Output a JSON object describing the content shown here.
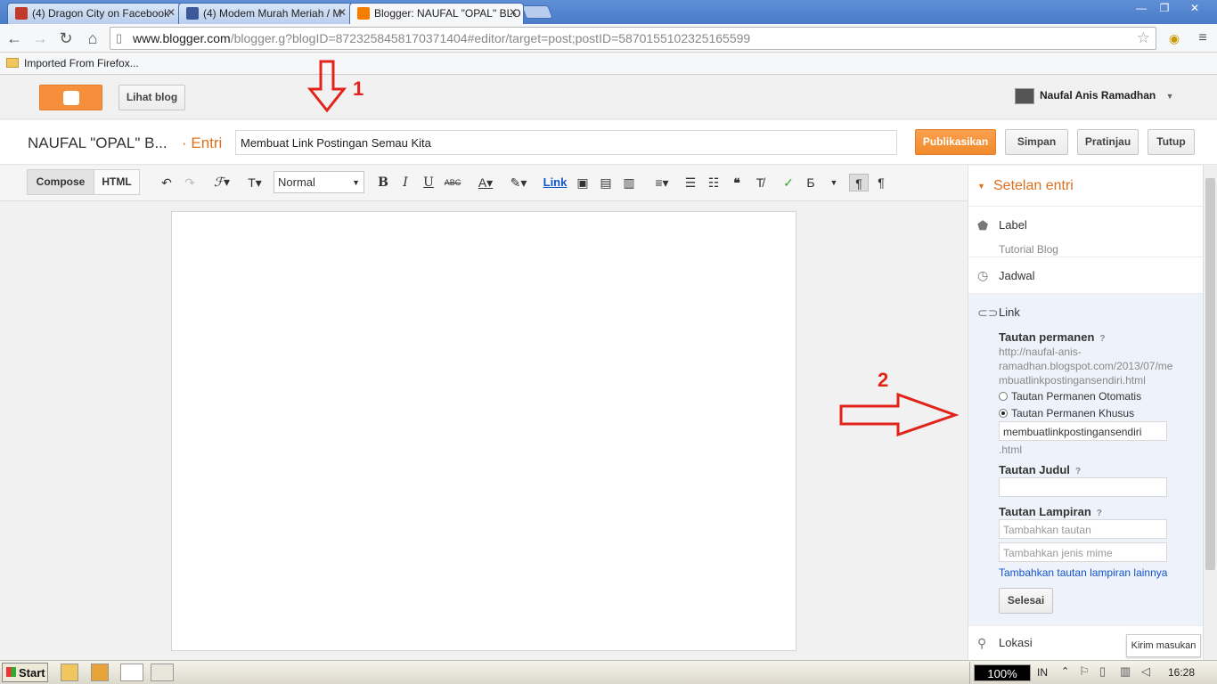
{
  "browser": {
    "tabs": [
      {
        "label": "(4) Dragon City on Facebook",
        "favicon_color": "#c0392b"
      },
      {
        "label": "(4) Modem Murah Meriah / M",
        "favicon_color": "#3b5998"
      },
      {
        "label": "Blogger: NAUFAL \"OPAL\" BLO",
        "favicon_color": "#f57d00"
      }
    ],
    "url_host": "www.blogger.com",
    "url_path": "/blogger.g?blogID=8723258458170371404#editor/target=post;postID=5870155102325165599",
    "bookmark": "Imported From Firefox..."
  },
  "blogger": {
    "view_blog": "Lihat blog",
    "user_name": "Naufal Anis Ramadhan",
    "blog_name": "NAUFAL \"OPAL\" B...",
    "entri": "· Entri",
    "post_title": "Membuat Link Postingan Semau Kita",
    "buttons": {
      "publish": "Publikasikan",
      "save": "Simpan",
      "preview": "Pratinjau",
      "close": "Tutup"
    }
  },
  "editor": {
    "compose": "Compose",
    "html": "HTML",
    "format": "Normal",
    "link": "Link"
  },
  "sidebar": {
    "header": "Setelan entri",
    "label_title": "Label",
    "label_value": "Tutorial Blog",
    "schedule": "Jadwal",
    "link_title": "Link",
    "permalink_title": "Tautan permanen",
    "permalink_url_1": "http://naufal-anis-",
    "permalink_url_2": "ramadhan.blogspot.com/2013/07/me",
    "permalink_url_3": "mbuatlinkpostingansendiri.html",
    "auto_option": "Tautan Permanen Otomatis",
    "custom_option": "Tautan Permanen Khusus",
    "custom_value": "membuatlinkpostingansendiri",
    "html_suffix": ".html",
    "title_link": "Tautan Judul",
    "attachment": "Tautan Lampiran",
    "attach_placeholder": "Tambahkan tautan",
    "mime_placeholder": "Tambahkan jenis mime",
    "add_more": "Tambahkan tautan lampiran lainnya",
    "done": "Selesai",
    "location": "Lokasi",
    "help": "?"
  },
  "feedback": "Kirim masukan",
  "annotations": {
    "one": "1",
    "two": "2"
  },
  "taskbar": {
    "start": "Start",
    "zoom": "100%",
    "lang": "IN",
    "time": "16:28"
  }
}
